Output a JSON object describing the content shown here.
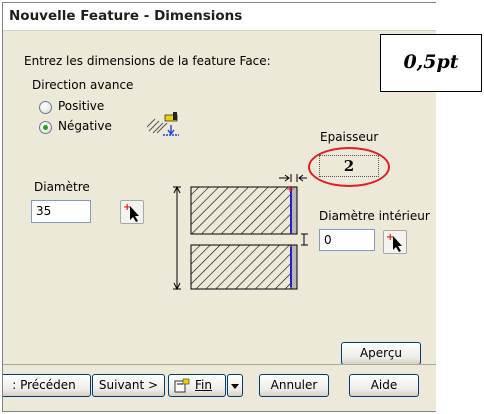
{
  "window": {
    "title": "Nouvelle Feature - Dimensions"
  },
  "instructions": "Entrez les dimensions de la feature Face:",
  "direction": {
    "label": "Direction avance",
    "options": [
      {
        "label": "Positive",
        "selected": false
      },
      {
        "label": "Négative",
        "selected": true
      }
    ]
  },
  "epaisseur": {
    "label": "Epaisseur",
    "value": "2"
  },
  "diametre": {
    "label": "Diamètre",
    "value": "35"
  },
  "diametre_interieur": {
    "label": "Diamètre intérieur",
    "value": "0"
  },
  "annotation": {
    "text": "0,5pt"
  },
  "buttons": {
    "apercu": "Aperçu",
    "precedent": ": Précéden",
    "suivant": "Suivant >",
    "fin": "Fin",
    "annuler": "Annuler",
    "aide": "Aide"
  },
  "colors": {
    "highlight_circle": "#e51c23",
    "radio_selected": "#21a121",
    "border_blue": "#003c74"
  }
}
